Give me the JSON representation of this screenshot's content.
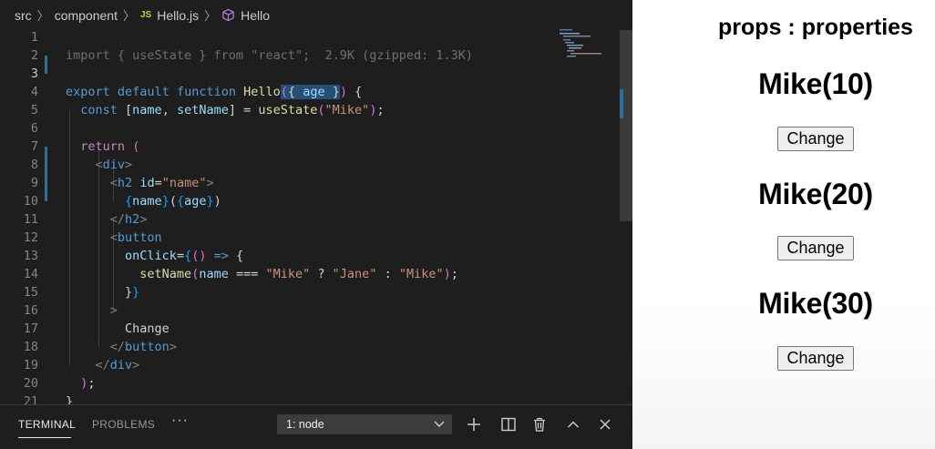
{
  "breadcrumb": {
    "items": [
      "src",
      "component",
      "Hello.js",
      "Hello"
    ],
    "js_badge": "JS"
  },
  "editor": {
    "active_line": 3,
    "line_numbers": [
      "1",
      "2",
      "3",
      "4",
      "5",
      "6",
      "7",
      "8",
      "9",
      "10",
      "11",
      "12",
      "13",
      "14",
      "15",
      "16",
      "17",
      "18",
      "19",
      "20",
      "21"
    ],
    "import_line": "import { useState } from \"react\";",
    "import_size_hint": "2.9K (gzipped: 1.3K)",
    "tokens": {
      "export": "export",
      "default": "default",
      "function": "function",
      "hello": "Hello",
      "age": "age",
      "const": "const",
      "name": "name",
      "setName": "setName",
      "useState": "useState",
      "mike": "\"Mike\"",
      "jane": "\"Jane\"",
      "return": "return",
      "div": "div",
      "h2": "h2",
      "id_attr": "id",
      "id_val": "\"name\"",
      "button": "button",
      "onClick": "onClick",
      "change_text": "Change"
    }
  },
  "panel": {
    "tabs": [
      "TERMINAL",
      "PROBLEMS"
    ],
    "active_tab": "TERMINAL",
    "more_label": "···",
    "terminal_select": "1: node"
  },
  "preview": {
    "title": "props : properties",
    "people": [
      {
        "heading": "Mike(10)",
        "button_label": "Change"
      },
      {
        "heading": "Mike(20)",
        "button_label": "Change"
      },
      {
        "heading": "Mike(30)",
        "button_label": "Change"
      }
    ]
  },
  "colors": {
    "editor_bg": "#1e1e1e",
    "keyword": "#569cd6",
    "control_keyword": "#c586c0",
    "function": "#dcdcaa",
    "variable": "#9cdcfe",
    "string": "#ce9178",
    "selection": "#264f78",
    "modified_gutter": "#2d6f9b"
  },
  "icons": [
    "chevron-right-icon",
    "js-file-icon",
    "cube-icon",
    "ellipsis-icon",
    "chevron-down-icon",
    "plus-icon",
    "split-icon",
    "trash-icon",
    "chevron-up-icon",
    "close-icon"
  ]
}
